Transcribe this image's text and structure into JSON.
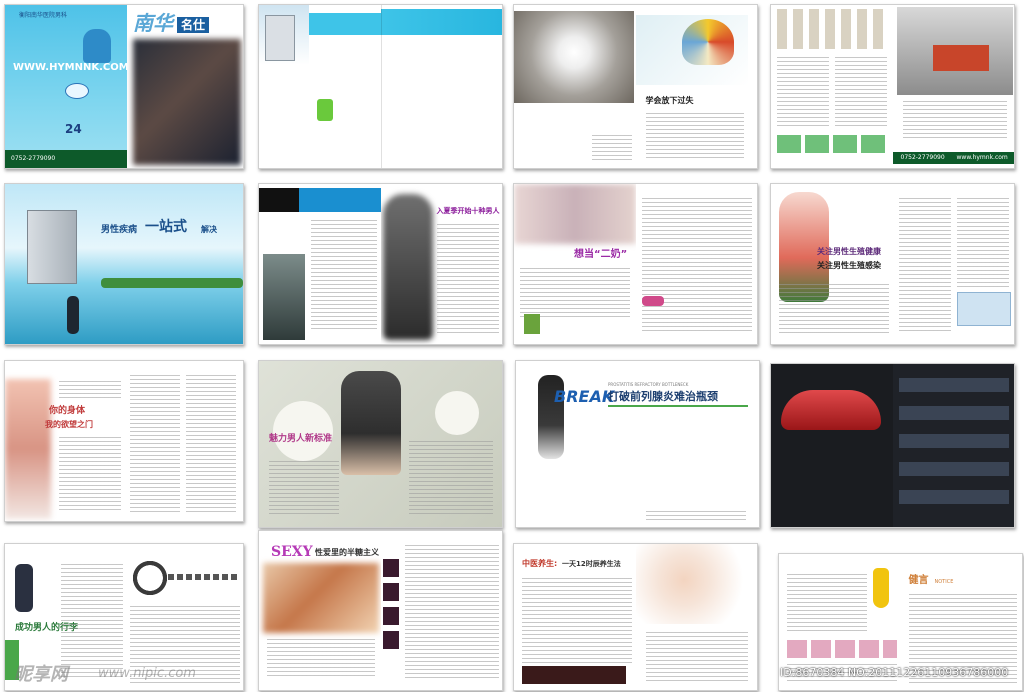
{
  "page": {
    "watermark_brand": "昵享网",
    "watermark_url": "www.nipic.com",
    "watermark_id": "ID:8670384 NO:20111226110936786000"
  },
  "spreads": {
    "s1": {
      "site": "WWW.HYMNNK.COM",
      "header": "衡阳南华医院男科",
      "phone": "0752-2779090",
      "masthead_a": "南华",
      "masthead_b": "名仕",
      "hours": "24"
    },
    "s3": {
      "title": "学会放下过失"
    },
    "s4": {
      "phone": "0752-2779090",
      "url": "www.hymnk.com"
    },
    "s5": {
      "headline_a": "男性疾病",
      "headline_b": "一站式",
      "headline_c": "解决"
    },
    "s6": {
      "title": "入夏季开始十种男人"
    },
    "s7": {
      "title": "想当“二奶”"
    },
    "s8": {
      "title_a": "关注男性生殖健康",
      "title_b": "关注男性生殖感染"
    },
    "s9": {
      "title_a": "你的身体",
      "title_b": "我的欲望之门"
    },
    "s10": {
      "title": "魅力男人新标准"
    },
    "s11": {
      "brand": "BREAK",
      "title": "打破前列腺炎难治瓶颈",
      "sub": "PROSTATITIS REFRACTORY BOTTLENECK"
    },
    "s13": {
      "title": "成功男人的行李"
    },
    "s14": {
      "brand": "SEXY",
      "title": "性爱里的半糖主义"
    },
    "s15": {
      "title_a": "中医养生:",
      "title_b": "一天12时辰养生法"
    },
    "s16": {
      "title": "健言",
      "sub": "NOTICE"
    }
  }
}
